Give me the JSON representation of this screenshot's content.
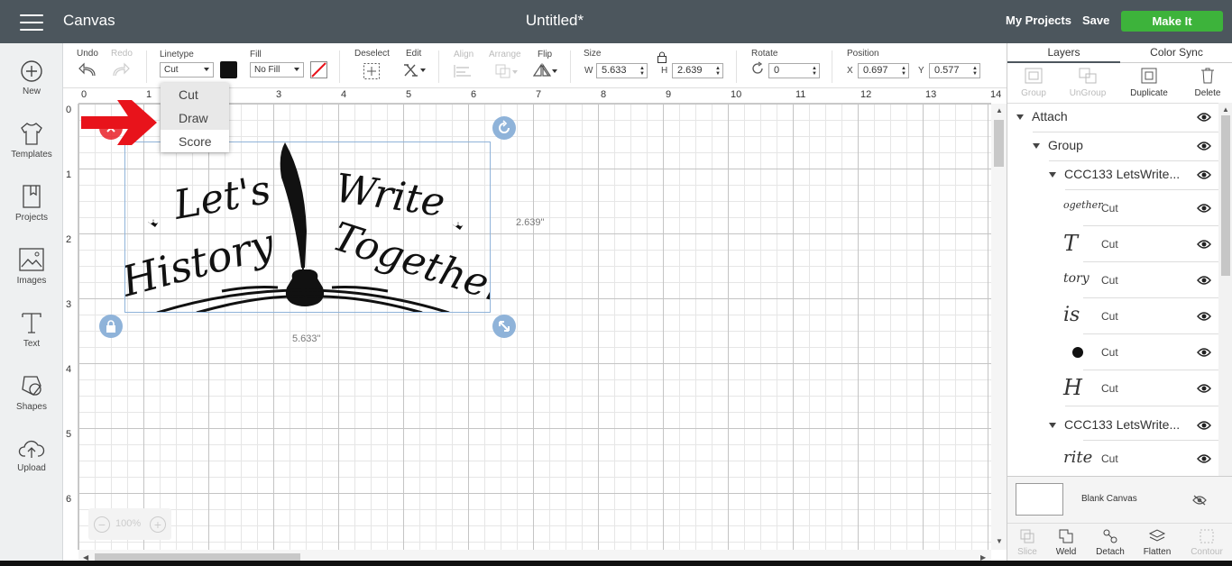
{
  "topbar": {
    "app_title": "Canvas",
    "doc_title": "Untitled*",
    "my_projects": "My Projects",
    "save": "Save",
    "make_it": "Make It"
  },
  "sidebar": {
    "items": [
      {
        "label": "New",
        "icon": "plus-circle-icon"
      },
      {
        "label": "Templates",
        "icon": "tshirt-icon"
      },
      {
        "label": "Projects",
        "icon": "bookmark-icon"
      },
      {
        "label": "Images",
        "icon": "image-icon"
      },
      {
        "label": "Text",
        "icon": "text-icon"
      },
      {
        "label": "Shapes",
        "icon": "shapes-icon"
      },
      {
        "label": "Upload",
        "icon": "cloud-upload-icon"
      }
    ]
  },
  "toolbar": {
    "undo": "Undo",
    "redo": "Redo",
    "linetype_label": "Linetype",
    "linetype_value": "Cut",
    "fill_label": "Fill",
    "fill_value": "No Fill",
    "deselect": "Deselect",
    "edit": "Edit",
    "align": "Align",
    "arrange": "Arrange",
    "flip": "Flip",
    "size_label": "Size",
    "w_label": "W",
    "w_value": "5.633",
    "h_label": "H",
    "h_value": "2.639",
    "rotate_label": "Rotate",
    "rotate_value": "0",
    "position_label": "Position",
    "x_label": "X",
    "x_value": "0.697",
    "y_label": "Y",
    "y_value": "0.577"
  },
  "linetype_menu": {
    "options": [
      "Cut",
      "Draw",
      "Score"
    ]
  },
  "rulers": {
    "top": [
      "0",
      "1",
      "2",
      "3",
      "4",
      "5",
      "6",
      "7",
      "8",
      "9",
      "10",
      "11",
      "12",
      "13",
      "14"
    ],
    "left": [
      "0",
      "1",
      "2",
      "3",
      "4",
      "5",
      "6"
    ]
  },
  "canvas": {
    "design_text": [
      "Let's",
      "Write",
      "History",
      "Together"
    ],
    "width_dim": "5.633\"",
    "height_dim": "2.639\"",
    "zoom": "100%"
  },
  "right_panel": {
    "tabs": [
      "Layers",
      "Color Sync"
    ],
    "actions": [
      "Group",
      "UnGroup",
      "Duplicate",
      "Delete"
    ],
    "layers": [
      {
        "name": "Attach",
        "level": 0
      },
      {
        "name": "Group",
        "level": 1
      },
      {
        "name": "CCC133 LetsWrite...",
        "level": 2
      },
      {
        "leaf": "Cut",
        "thumb": "ogether"
      },
      {
        "leaf": "Cut",
        "thumb": "T"
      },
      {
        "leaf": "Cut",
        "thumb": "tory"
      },
      {
        "leaf": "Cut",
        "thumb": "is"
      },
      {
        "leaf": "Cut",
        "thumb": "dot"
      },
      {
        "leaf": "Cut",
        "thumb": "H"
      },
      {
        "name": "CCC133 LetsWrite...",
        "level": 2
      },
      {
        "leaf": "Cut",
        "thumb": "rite"
      }
    ],
    "blank_canvas": "Blank Canvas",
    "bottom_actions": [
      "Slice",
      "Weld",
      "Detach",
      "Flatten",
      "Contour"
    ]
  },
  "colors": {
    "topbar": "#4c565d",
    "make_it": "#3db33b",
    "selection": "#8fb3d9",
    "red_arrow": "#e8131b"
  }
}
